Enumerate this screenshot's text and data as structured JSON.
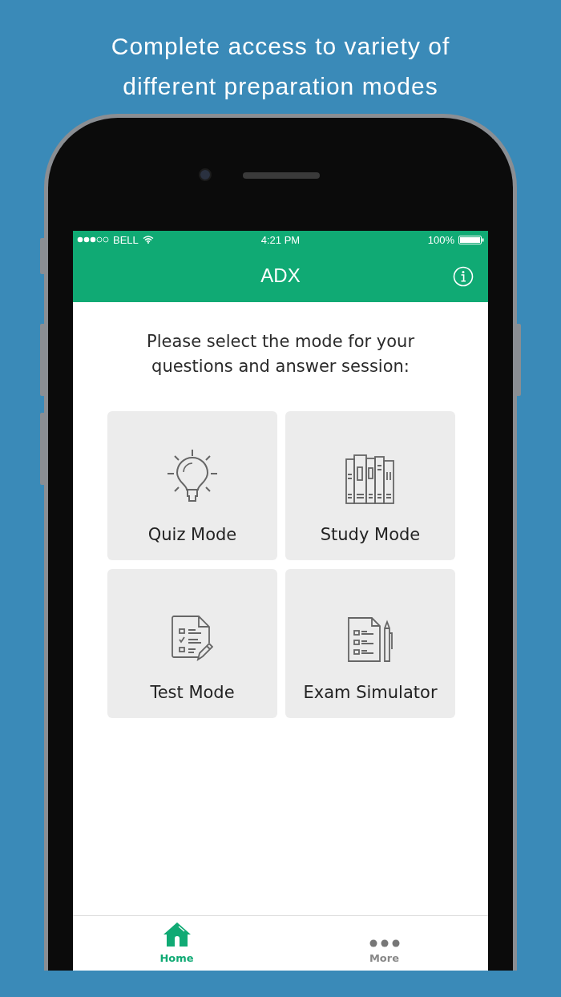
{
  "headline": "Complete access to variety of different preparation modes",
  "status_bar": {
    "carrier": "BELL",
    "time": "4:21 PM",
    "battery": "100%"
  },
  "nav_bar": {
    "title": "ADX"
  },
  "prompt": "Please select the mode for your questions and answer session:",
  "modes": [
    {
      "label": "Quiz Mode",
      "kind": "bulb"
    },
    {
      "label": "Study Mode",
      "kind": "books"
    },
    {
      "label": "Test Mode",
      "kind": "test"
    },
    {
      "label": "Exam Simulator",
      "kind": "exam"
    }
  ],
  "tabs": [
    {
      "label": "Home",
      "kind": "home",
      "selected": true
    },
    {
      "label": "More",
      "kind": "more",
      "selected": false
    }
  ]
}
